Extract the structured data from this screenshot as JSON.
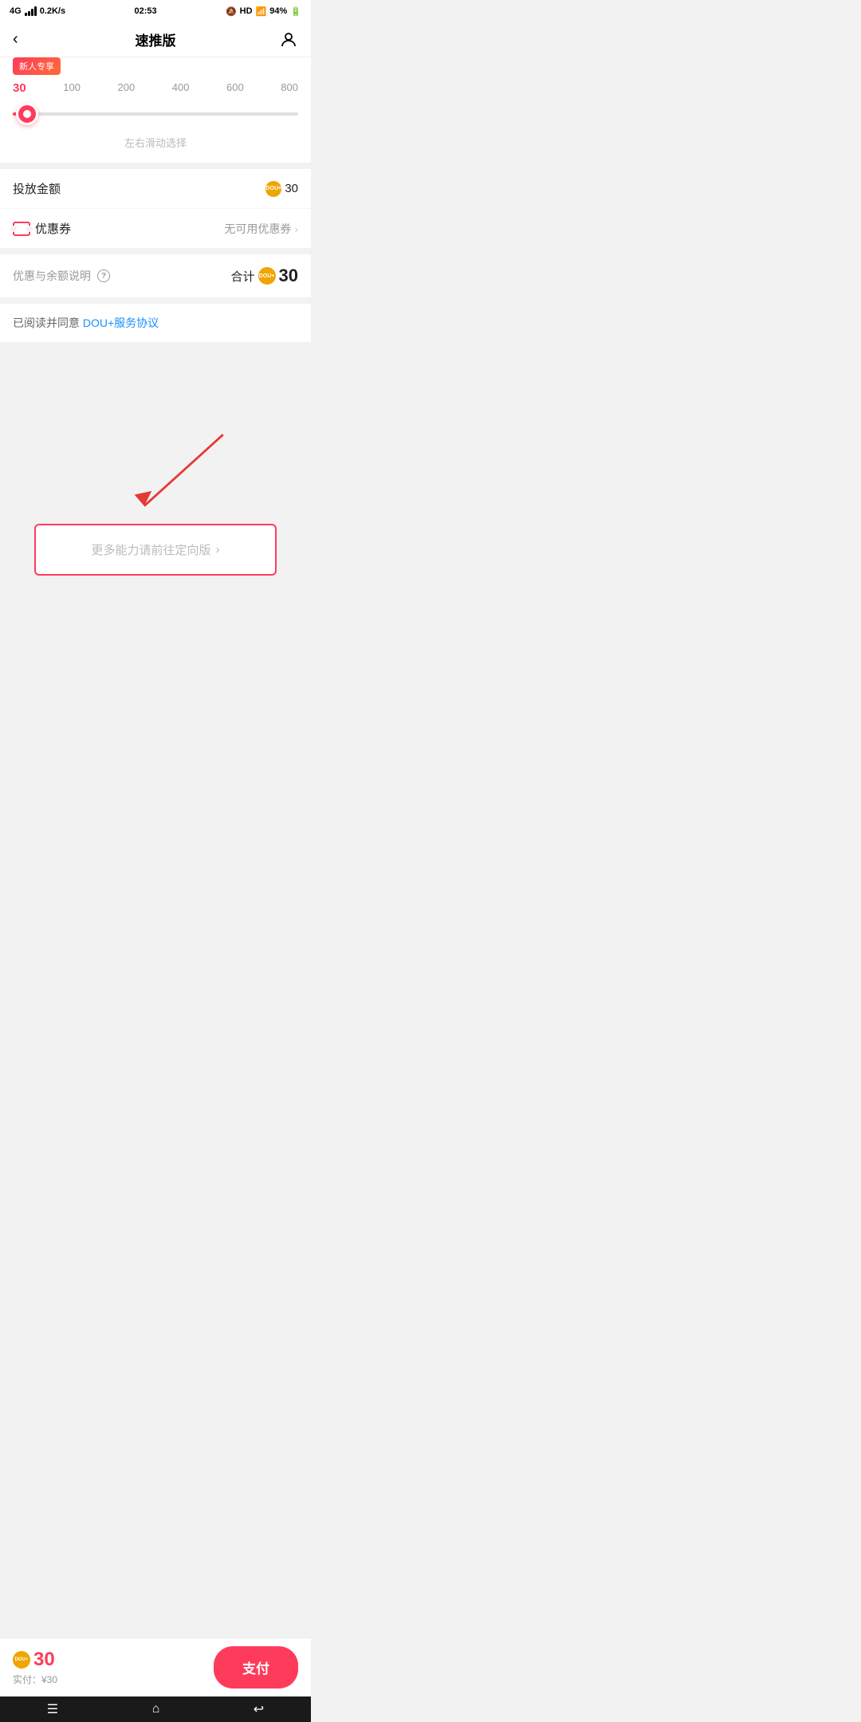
{
  "statusBar": {
    "network": "4G",
    "signal": "..|||",
    "speed": "0.2K/s",
    "time": "02:53",
    "notifications": "HD",
    "wifi": "94%",
    "battery": "94%"
  },
  "navBar": {
    "backLabel": "‹",
    "title": "速推版",
    "userIconLabel": "用户"
  },
  "slider": {
    "promoTag": "新人专享",
    "labels": [
      "30",
      "100",
      "200",
      "400",
      "600",
      "800"
    ],
    "activeLabel": "30",
    "hint": "左右滑动选择"
  },
  "infoRows": {
    "amountLabel": "投放金额",
    "amountValue": "30",
    "couponLabel": "优惠券",
    "couponValue": "无可用优惠券"
  },
  "summary": {
    "discountLabel": "优惠与余额说明",
    "helpIcon": "?",
    "totalLabel": "合计",
    "totalValue": "30"
  },
  "agreement": {
    "prefix": "已阅读并同意 ",
    "linkText": "DOU+服务协议"
  },
  "moreFeatures": {
    "text": "更多能力请前往定向版",
    "arrow": "›"
  },
  "bottomBar": {
    "coinAmount": "30",
    "actualLabel": "实付：¥30",
    "payButtonLabel": "支付"
  },
  "systemNav": {
    "menuIcon": "☰",
    "homeIcon": "⌂",
    "backIcon": "↩"
  }
}
